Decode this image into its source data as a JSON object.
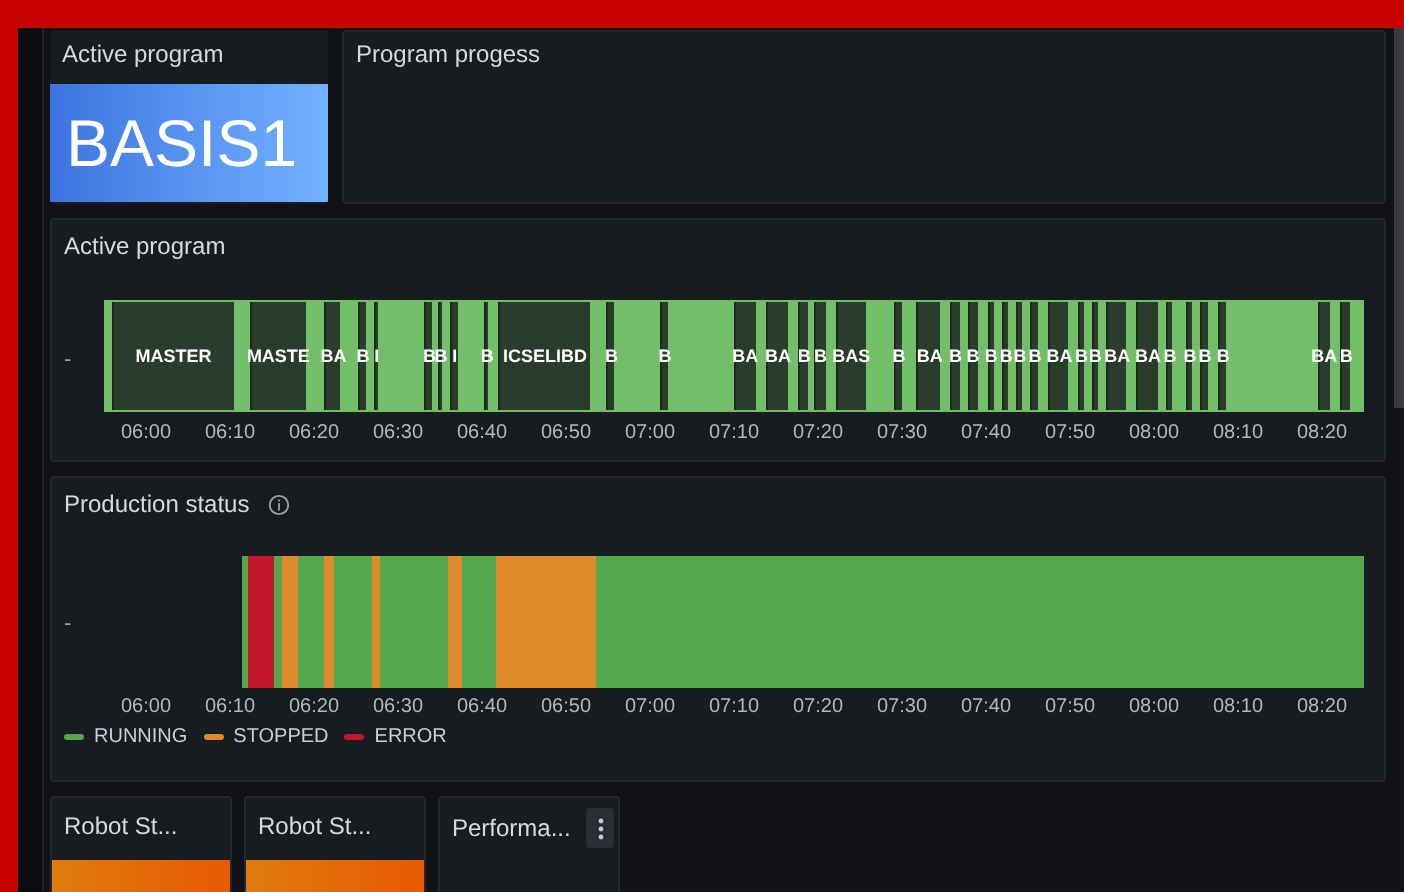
{
  "stat_panel": {
    "title": "Active program",
    "value": "BASIS1"
  },
  "progress_panel": {
    "title": "Program progess"
  },
  "program_timeline": {
    "title": "Active program",
    "row_label": "-",
    "segments": [
      {
        "kind": "idle"
      },
      {
        "kind": "program",
        "label": "MASTER"
      },
      {
        "kind": "idle"
      },
      {
        "kind": "program",
        "label": "MASTE"
      },
      {
        "kind": "idle"
      },
      {
        "kind": "program",
        "label": "BA"
      },
      {
        "kind": "idle"
      },
      {
        "kind": "program",
        "label": "B"
      },
      {
        "kind": "idle"
      },
      {
        "kind": "program",
        "label": "I"
      },
      {
        "kind": "idle"
      },
      {
        "kind": "program",
        "label": "B"
      },
      {
        "kind": "idle"
      },
      {
        "kind": "program",
        "label": "B"
      },
      {
        "kind": "idle"
      },
      {
        "kind": "program",
        "label": "I"
      },
      {
        "kind": "idle"
      },
      {
        "kind": "program",
        "label": "B"
      },
      {
        "kind": "idle"
      },
      {
        "kind": "program",
        "label": "ICSELIBD"
      },
      {
        "kind": "idle"
      },
      {
        "kind": "program",
        "label": "B"
      },
      {
        "kind": "idle"
      },
      {
        "kind": "program",
        "label": "B"
      },
      {
        "kind": "idle"
      },
      {
        "kind": "program",
        "label": "BA"
      },
      {
        "kind": "idle"
      },
      {
        "kind": "program",
        "label": "BA"
      },
      {
        "kind": "idle"
      },
      {
        "kind": "program",
        "label": "B"
      },
      {
        "kind": "idle"
      },
      {
        "kind": "program",
        "label": "B"
      },
      {
        "kind": "idle"
      },
      {
        "kind": "program",
        "label": "BAS"
      },
      {
        "kind": "idle"
      },
      {
        "kind": "program",
        "label": "B"
      },
      {
        "kind": "idle"
      },
      {
        "kind": "program",
        "label": "BA"
      },
      {
        "kind": "idle"
      },
      {
        "kind": "program",
        "label": "B"
      },
      {
        "kind": "idle"
      },
      {
        "kind": "program",
        "label": "B"
      },
      {
        "kind": "idle"
      },
      {
        "kind": "program",
        "label": "B"
      },
      {
        "kind": "idle"
      },
      {
        "kind": "program",
        "label": "B"
      },
      {
        "kind": "idle"
      },
      {
        "kind": "program",
        "label": "B"
      },
      {
        "kind": "idle"
      },
      {
        "kind": "program",
        "label": "B"
      },
      {
        "kind": "idle"
      },
      {
        "kind": "program",
        "label": "BA"
      },
      {
        "kind": "idle"
      },
      {
        "kind": "program",
        "label": "B"
      },
      {
        "kind": "idle"
      },
      {
        "kind": "program",
        "label": "B"
      },
      {
        "kind": "idle"
      },
      {
        "kind": "program",
        "label": "BA"
      },
      {
        "kind": "idle"
      },
      {
        "kind": "program",
        "label": "BA"
      },
      {
        "kind": "idle"
      },
      {
        "kind": "program",
        "label": "B"
      },
      {
        "kind": "idle"
      },
      {
        "kind": "program",
        "label": "B"
      },
      {
        "kind": "idle"
      },
      {
        "kind": "program",
        "label": "B"
      },
      {
        "kind": "idle"
      },
      {
        "kind": "program",
        "label": "B"
      },
      {
        "kind": "idle"
      },
      {
        "kind": "program",
        "label": "BA"
      },
      {
        "kind": "idle"
      },
      {
        "kind": "program",
        "label": "B"
      },
      {
        "kind": "idle"
      }
    ],
    "ticks": [
      "06:00",
      "06:10",
      "06:20",
      "06:30",
      "06:40",
      "06:50",
      "07:00",
      "07:10",
      "07:20",
      "07:30",
      "07:40",
      "07:50",
      "08:00",
      "08:10",
      "08:20"
    ]
  },
  "production_status": {
    "title": "Production status",
    "row_label": "-",
    "segments": [
      {
        "kind": "none"
      },
      {
        "kind": "running"
      },
      {
        "kind": "error"
      },
      {
        "kind": "running"
      },
      {
        "kind": "stopped"
      },
      {
        "kind": "running"
      },
      {
        "kind": "stopped"
      },
      {
        "kind": "running"
      },
      {
        "kind": "stopped"
      },
      {
        "kind": "running"
      },
      {
        "kind": "stopped"
      },
      {
        "kind": "running"
      },
      {
        "kind": "stopped"
      },
      {
        "kind": "running"
      }
    ],
    "ticks": [
      "06:00",
      "06:10",
      "06:20",
      "06:30",
      "06:40",
      "06:50",
      "07:00",
      "07:10",
      "07:20",
      "07:30",
      "07:40",
      "07:50",
      "08:00",
      "08:10",
      "08:20"
    ],
    "legend": [
      {
        "kind": "running",
        "label": "RUNNING",
        "color": "#56a64b"
      },
      {
        "kind": "stopped",
        "label": "STOPPED",
        "color": "#e0892b"
      },
      {
        "kind": "error",
        "label": "ERROR",
        "color": "#c4162a"
      }
    ]
  },
  "bottom_panels": [
    {
      "title": "Robot St...",
      "kind": "stat"
    },
    {
      "title": "Robot St...",
      "kind": "stat"
    },
    {
      "title": "Performa...",
      "kind": "menu"
    }
  ]
}
